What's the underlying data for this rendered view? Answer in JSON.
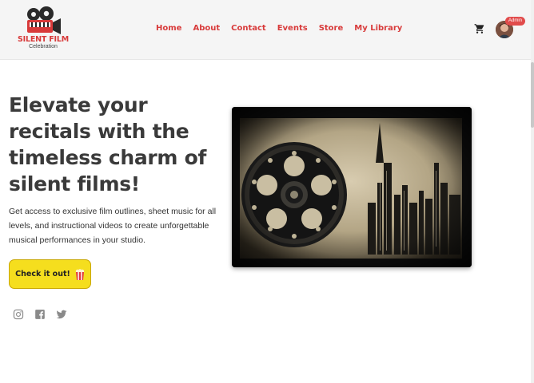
{
  "brand": {
    "title": "SILENT FILM",
    "subtitle": "Celebration"
  },
  "nav": {
    "items": [
      {
        "label": "Home"
      },
      {
        "label": "About"
      },
      {
        "label": "Contact"
      },
      {
        "label": "Events"
      },
      {
        "label": "Store"
      },
      {
        "label": "My Library"
      }
    ]
  },
  "user": {
    "badge": "Admin"
  },
  "hero": {
    "title": "Elevate your recitals with the timeless charm of silent films!",
    "description": "Get access to exclusive film outlines, sheet music for all levels, and instructional videos to create unforgettable musical performances in your studio.",
    "cta_label": "Check it out!"
  },
  "icons": {
    "cart": "cart-icon",
    "cta": "popcorn-icon",
    "social": [
      "instagram-icon",
      "facebook-icon",
      "twitter-icon"
    ]
  },
  "colors": {
    "brand_red": "#d83a3a",
    "cta_yellow": "#f5de1e",
    "badge_red": "#e14b4b",
    "header_bg": "#f5f5f5"
  }
}
